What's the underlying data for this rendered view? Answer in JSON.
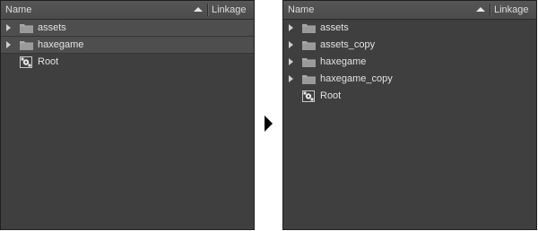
{
  "left_panel": {
    "header": {
      "name_label": "Name",
      "linkage_label": "Linkage"
    },
    "items": [
      {
        "label": "assets",
        "type": "folder"
      },
      {
        "label": "haxegame",
        "type": "folder"
      },
      {
        "label": "Root",
        "type": "symbol"
      }
    ]
  },
  "right_panel": {
    "header": {
      "name_label": "Name",
      "linkage_label": "Linkage"
    },
    "items": [
      {
        "label": "assets",
        "type": "folder"
      },
      {
        "label": "assets_copy",
        "type": "folder"
      },
      {
        "label": "haxegame",
        "type": "folder"
      },
      {
        "label": "haxegame_copy",
        "type": "folder"
      },
      {
        "label": "Root",
        "type": "symbol"
      }
    ]
  },
  "icons": {
    "expand": "triangle-right-icon",
    "folder": "folder-icon",
    "symbol": "movieclip-symbol-icon",
    "sort": "sort-ascending-icon",
    "transition": "arrow-right-icon"
  },
  "colors": {
    "panel_bg": "#3f3f3f",
    "header_bg": "#4f4f4f",
    "selected_row": "#4e4e4e",
    "text": "#e2e2e2"
  }
}
